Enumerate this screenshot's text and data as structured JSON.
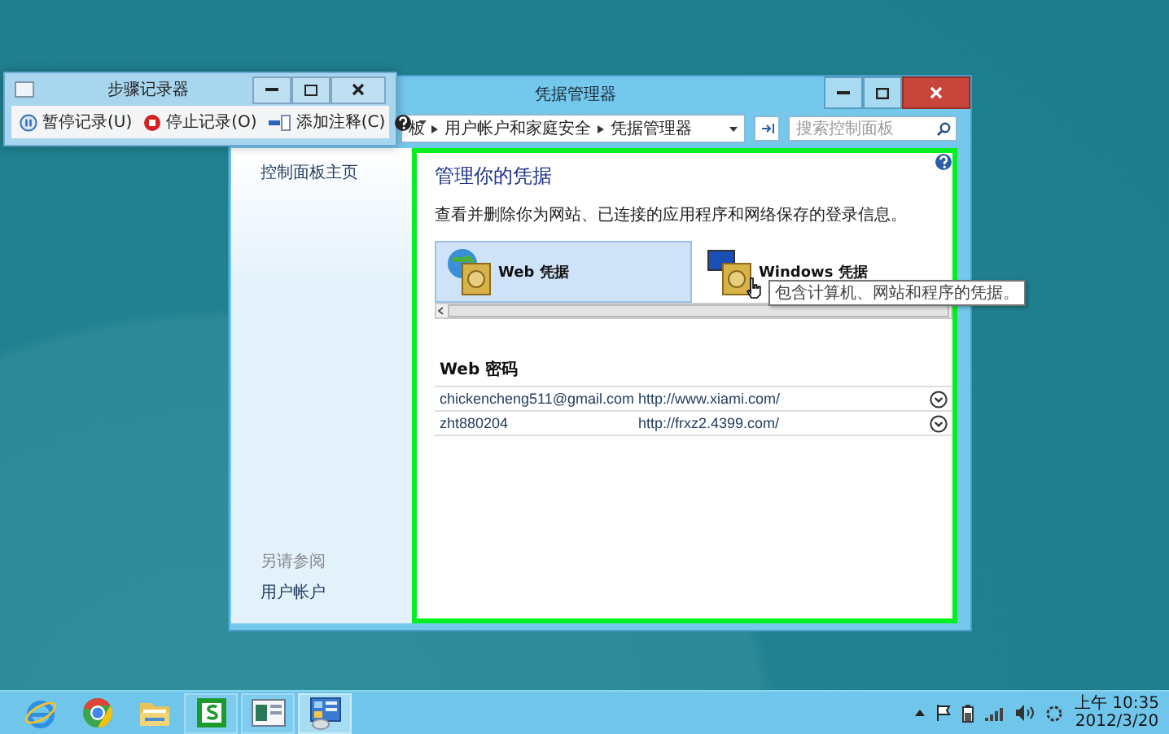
{
  "steps_recorder": {
    "title": "步骤记录器",
    "buttons": [
      {
        "label": "暂停记录(U)",
        "kind": "pause"
      },
      {
        "label": "停止记录(O)",
        "kind": "stop"
      },
      {
        "label": "添加注释(C)",
        "kind": "comment"
      }
    ]
  },
  "window": {
    "title": "凭据管理器",
    "breadcrumb": [
      "板",
      "用户帐户和家庭安全",
      "凭据管理器"
    ],
    "search": {
      "placeholder": "搜索控制面板"
    }
  },
  "sidebar": {
    "items": [
      "控制面板主页"
    ],
    "see_also_heading": "另请参阅",
    "see_also_items": [
      "用户帐户"
    ]
  },
  "content": {
    "heading": "管理你的凭据",
    "description": "查看并删除你为网站、已连接的应用程序和网络保存的登录信息。",
    "tiles": [
      {
        "label": "Web 凭据",
        "kind": "web",
        "selected": true
      },
      {
        "label": "Windows 凭据",
        "kind": "windows",
        "selected": false
      }
    ],
    "tooltip": "包含计算机、网站和程序的凭据。",
    "section_title": "Web 密码",
    "rows": [
      {
        "user": "chickencheng511@gmail.com",
        "site": "http://www.xiami.com/"
      },
      {
        "user": "zht880204",
        "site": "http://frxz2.4399.com/"
      }
    ]
  },
  "taskbar": {
    "apps": [
      {
        "kind": "ie",
        "running": false,
        "selected": false
      },
      {
        "kind": "chrome",
        "running": false,
        "selected": false
      },
      {
        "kind": "folder",
        "running": false,
        "selected": false
      },
      {
        "kind": "spreadsheet",
        "running": true,
        "selected": false
      },
      {
        "kind": "recorder",
        "running": true,
        "selected": false
      },
      {
        "kind": "control-panel",
        "running": true,
        "selected": true
      }
    ],
    "clock": {
      "time": "上午 10:35",
      "date": "2012/3/20"
    }
  }
}
